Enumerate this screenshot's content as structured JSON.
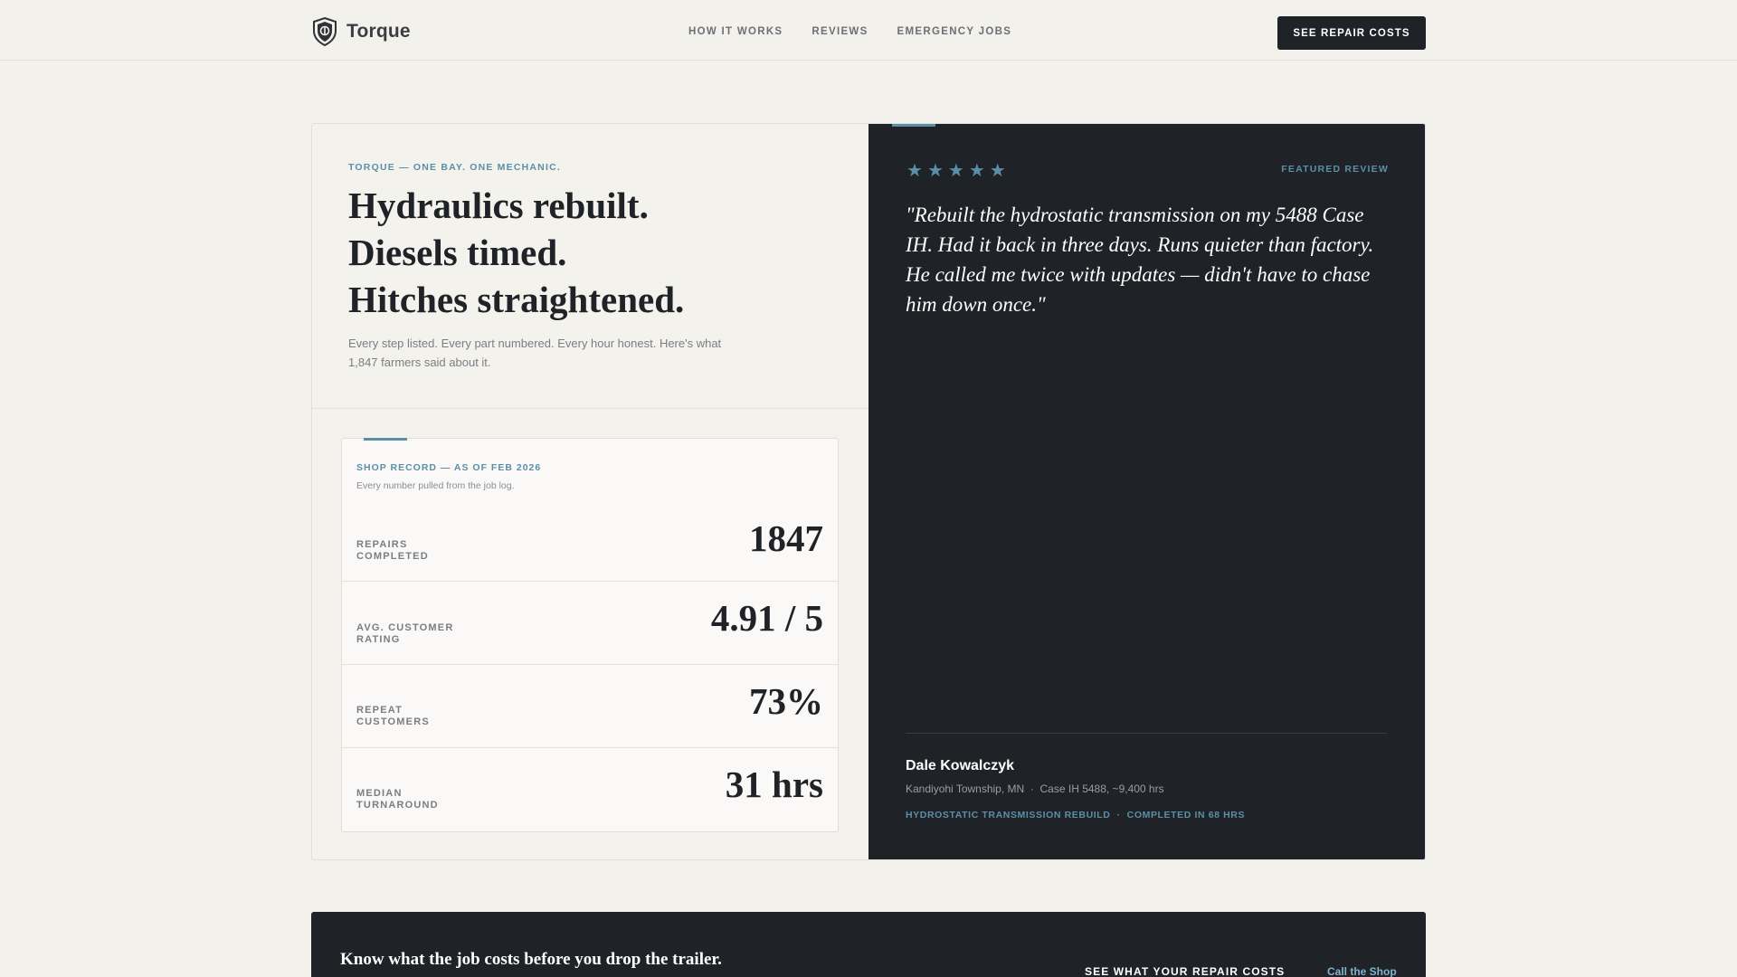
{
  "header": {
    "brand": "Torque",
    "nav": [
      "HOW IT WORKS",
      "REVIEWS",
      "EMERGENCY JOBS"
    ],
    "cta": "SEE REPAIR COSTS"
  },
  "hero": {
    "eyebrow": "TORQUE — ONE BAY. ONE MECHANIC.",
    "headline": [
      "Hydraulics rebuilt.",
      "Diesels timed.",
      "Hitches straightened."
    ],
    "sub": "Every step listed. Every part numbered. Every hour honest. Here's what 1,847 farmers said about it."
  },
  "record": {
    "title": "SHOP RECORD — AS OF FEB 2026",
    "note": "Every number pulled from the job log.",
    "stats": [
      {
        "label": "REPAIRS COMPLETED",
        "value": "1847"
      },
      {
        "label": "AVG. CUSTOMER RATING",
        "value": "4.91 / 5"
      },
      {
        "label": "REPEAT CUSTOMERS",
        "value": "73%"
      },
      {
        "label": "MEDIAN TURNAROUND",
        "value": "31 hrs"
      }
    ]
  },
  "review": {
    "stars": [
      "★",
      "★",
      "★",
      "★",
      "★"
    ],
    "label": "FEATURED REVIEW",
    "quote": "\"Rebuilt the hydrostatic transmission on my 5488 Case IH. Had it back in three days. Runs quieter than factory. He called me twice with updates — didn't have to chase him down once.\"",
    "author": "Dale Kowalczyk",
    "meta": "Kandiyohi Township, MN  ·  Case IH 5488, ~9,400 hrs",
    "tags": "HYDROSTATIC TRANSMISSION REBUILD  ·  COMPLETED IN 68 HRS"
  },
  "bottom": {
    "message": "Know what the job costs before you drop the trailer.",
    "see": "SEE WHAT YOUR REPAIR COSTS",
    "call": "Call the Shop"
  },
  "colors": {
    "accent": "#5b8fa8",
    "dark": "#1f2226",
    "background": "#f3f1ec"
  },
  "icons": {
    "brand": "shield-icon",
    "rating": "star-icon"
  }
}
